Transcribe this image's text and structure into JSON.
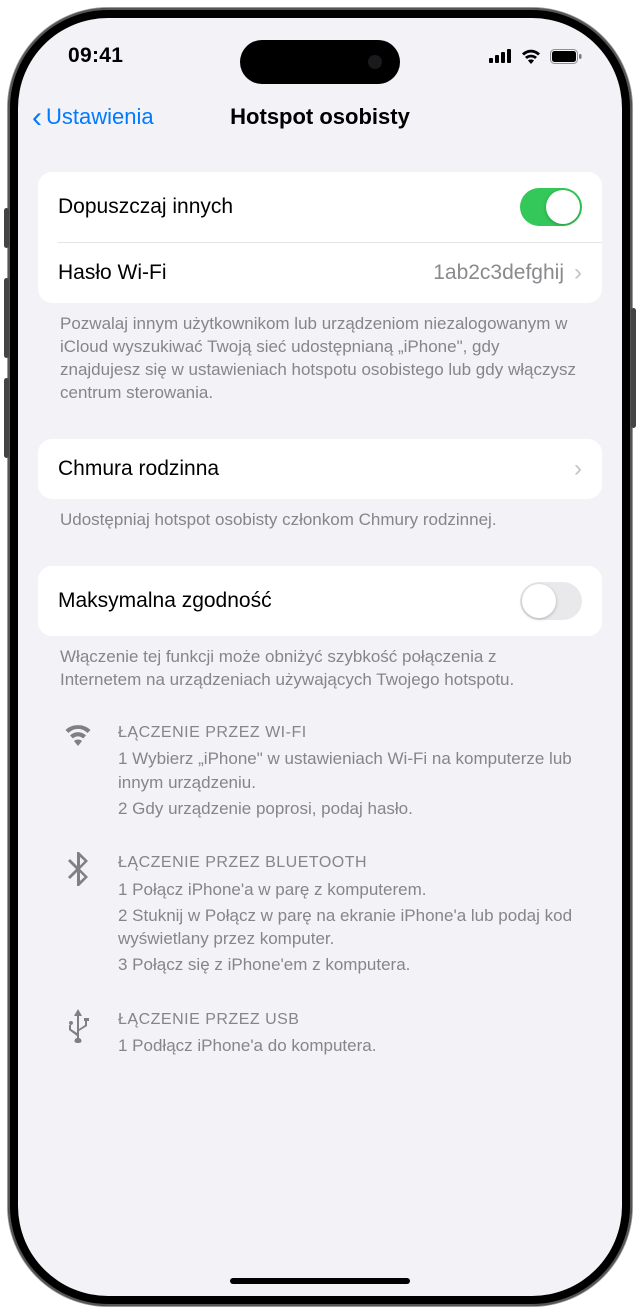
{
  "status": {
    "time": "09:41"
  },
  "nav": {
    "back": "Ustawienia",
    "title": "Hotspot osobisty"
  },
  "group1": {
    "allow_label": "Dopuszczaj innych",
    "pwd_label": "Hasło Wi-Fi",
    "pwd_value": "1ab2c3defghij",
    "footer": "Pozwalaj innym użytkownikom lub urządzeniom niezalogowanym w iCloud wyszukiwać Twoją sieć udostępnianą „iPhone\", gdy znajdujesz się w ustawieniach hotspotu osobistego lub gdy włączysz centrum sterowania."
  },
  "group2": {
    "label": "Chmura rodzinna",
    "footer": "Udostępniaj hotspot osobisty członkom Chmury rodzinnej."
  },
  "group3": {
    "label": "Maksymalna zgodność",
    "footer": "Włączenie tej funkcji może obniżyć szybkość połączenia z Internetem na urządzeniach używających Twojego hotspotu."
  },
  "instructions": {
    "wifi": {
      "title": "ŁĄCZENIE PRZEZ WI-FI",
      "s1": "1 Wybierz „iPhone\" w ustawieniach Wi-Fi na komputerze lub innym urządzeniu.",
      "s2": "2 Gdy urządzenie poprosi, podaj hasło."
    },
    "bt": {
      "title": "ŁĄCZENIE PRZEZ BLUETOOTH",
      "s1": "1 Połącz iPhone'a w parę z komputerem.",
      "s2": "2 Stuknij w Połącz w parę na ekranie iPhone'a lub podaj kod wyświetlany przez komputer.",
      "s3": "3 Połącz się z iPhone'em z komputera."
    },
    "usb": {
      "title": "ŁĄCZENIE PRZEZ USB",
      "s1": "1 Podłącz iPhone'a do komputera."
    }
  }
}
